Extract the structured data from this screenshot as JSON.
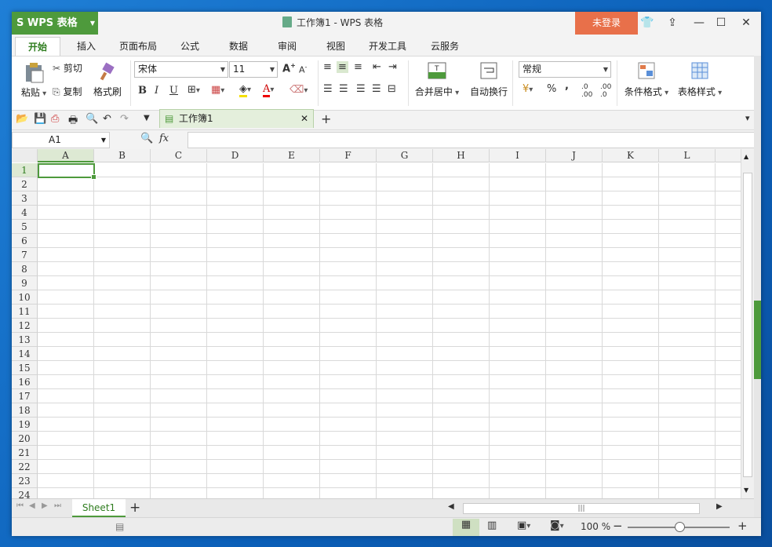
{
  "app": {
    "name": "WPS 表格",
    "window_title": "工作簿1 - WPS 表格",
    "login_label": "未登录"
  },
  "ribbon_tabs": [
    "开始",
    "插入",
    "页面布局",
    "公式",
    "数据",
    "审阅",
    "视图",
    "开发工具",
    "云服务"
  ],
  "ribbon": {
    "paste": "粘贴",
    "cut": "剪切",
    "copy": "复制",
    "format_painter": "格式刷",
    "font_name": "宋体",
    "font_size": "11",
    "bold": "B",
    "italic": "I",
    "underline": "U",
    "merge_center": "合并居中",
    "wrap_text": "自动换行",
    "number_format": "常规",
    "percent": "%",
    "comma": ",",
    "cond_format": "条件格式",
    "table_style": "表格样式"
  },
  "doc_tab": "工作簿1",
  "name_box": "A1",
  "fx_label": "fx",
  "columns": [
    "A",
    "B",
    "C",
    "D",
    "E",
    "F",
    "G",
    "H",
    "I",
    "J",
    "K",
    "L"
  ],
  "rows": [
    "1",
    "2",
    "3",
    "4",
    "5",
    "6",
    "7",
    "8",
    "9",
    "10",
    "11",
    "12",
    "13",
    "14",
    "15",
    "16",
    "17",
    "18",
    "19",
    "20",
    "21",
    "22",
    "23",
    "24"
  ],
  "sheet_tab": "Sheet1",
  "status": {
    "zoom": "100 %"
  },
  "colors": {
    "brand_green": "#4e9a3c",
    "login_orange": "#e8704a"
  }
}
